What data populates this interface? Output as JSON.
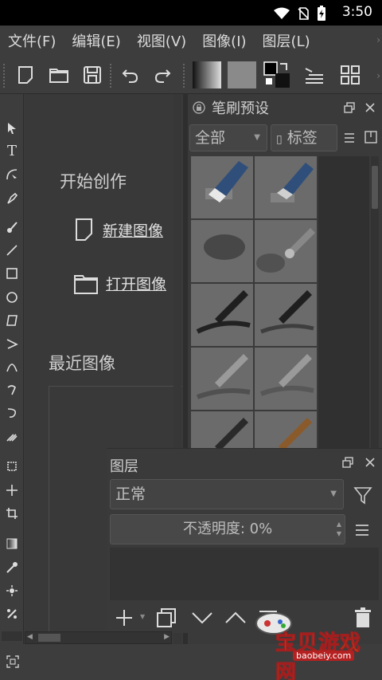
{
  "status_bar": {
    "time": "3:50",
    "icons": [
      "wifi-icon",
      "no-sim-icon",
      "battery-charging-icon"
    ]
  },
  "menu": {
    "items": [
      "文件(F)",
      "编辑(E)",
      "视图(V)",
      "图像(I)",
      "图层(L)"
    ]
  },
  "toolbar": {
    "buttons": [
      "new-document-icon",
      "open-folder-icon",
      "save-icon",
      "undo-icon",
      "redo-icon",
      "gradient-swatch",
      "pattern-swatch",
      "color-swap-icon",
      "brush-settings-icon",
      "workspace-grid-icon"
    ]
  },
  "welcome": {
    "title": "开始创作",
    "new_image": "新建图像",
    "open_image": "打开图像",
    "recent_title": "最近图像"
  },
  "brush_panel": {
    "title": "笔刷预设",
    "filter_value": "全部",
    "tag_label": "标签"
  },
  "layers_panel": {
    "title": "图层",
    "blend_mode": "正常",
    "opacity_text": "不透明度:  0%"
  },
  "watermark": {
    "text": "宝贝游戏网",
    "url": "baobeiy.com"
  },
  "colors": {
    "background": "#3a3a3a",
    "panel": "#3d3d3d",
    "accent_watermark": "#f2c500"
  }
}
